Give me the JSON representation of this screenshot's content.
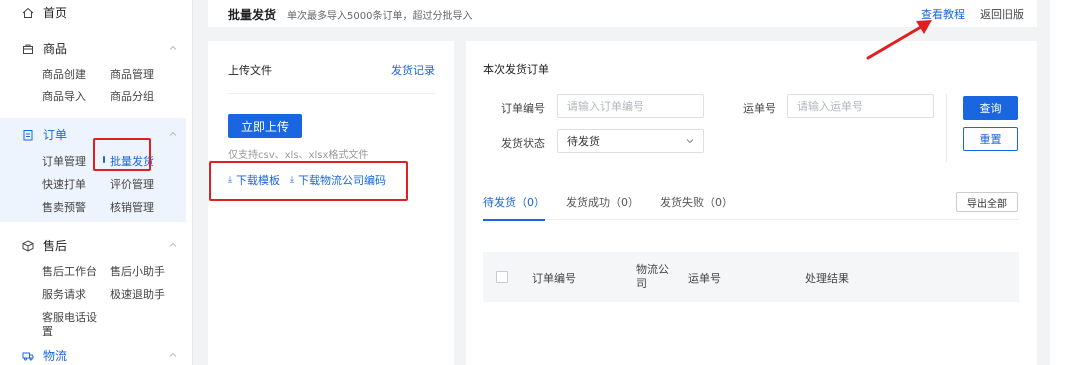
{
  "sidebar": {
    "home": {
      "label": "首页",
      "icon": "home-icon"
    },
    "sections": [
      {
        "label": "商品",
        "icon": "bag-icon",
        "items": [
          "商品创建",
          "商品管理",
          "商品导入",
          "商品分组"
        ]
      },
      {
        "label": "订单",
        "icon": "clipboard-icon",
        "items": [
          "订单管理",
          "批量发货",
          "快速打单",
          "评价管理",
          "售卖预警",
          "核销管理"
        ]
      },
      {
        "label": "售后",
        "icon": "box-icon",
        "items": [
          "售后工作台",
          "售后小助手",
          "服务请求",
          "极速退助手",
          "客服电话设",
          "置"
        ]
      },
      {
        "label": "物流",
        "icon": "truck-icon",
        "items": []
      }
    ]
  },
  "header": {
    "title": "批量发货",
    "subtitle": "单次最多导入5000条订单，超过分批导入",
    "tutorial_link": "查看教程",
    "old_version_link": "返回旧版"
  },
  "upload": {
    "title": "上传文件",
    "record_link": "发货记录",
    "upload_button": "立即上传",
    "hint": "仅支持csv、xls、xlsx格式文件",
    "download_template": "下载模板",
    "download_codes": "下载物流公司编码"
  },
  "orders": {
    "title": "本次发货订单",
    "order_no_label": "订单编号",
    "order_no_placeholder": "请输入订单编号",
    "waybill_label": "运单号",
    "waybill_placeholder": "请输入运单号",
    "status_label": "发货状态",
    "status_value": "待发货",
    "query_button": "查询",
    "reset_button": "重置",
    "tabs": [
      "待发货（0）",
      "发货成功（0）",
      "发货失败（0）"
    ],
    "export_button": "导出全部",
    "columns": [
      "订单编号",
      "物流公司",
      "运单号",
      "处理结果"
    ]
  },
  "colors": {
    "accent": "#1a66e0",
    "annotation_red": "#e02020"
  }
}
